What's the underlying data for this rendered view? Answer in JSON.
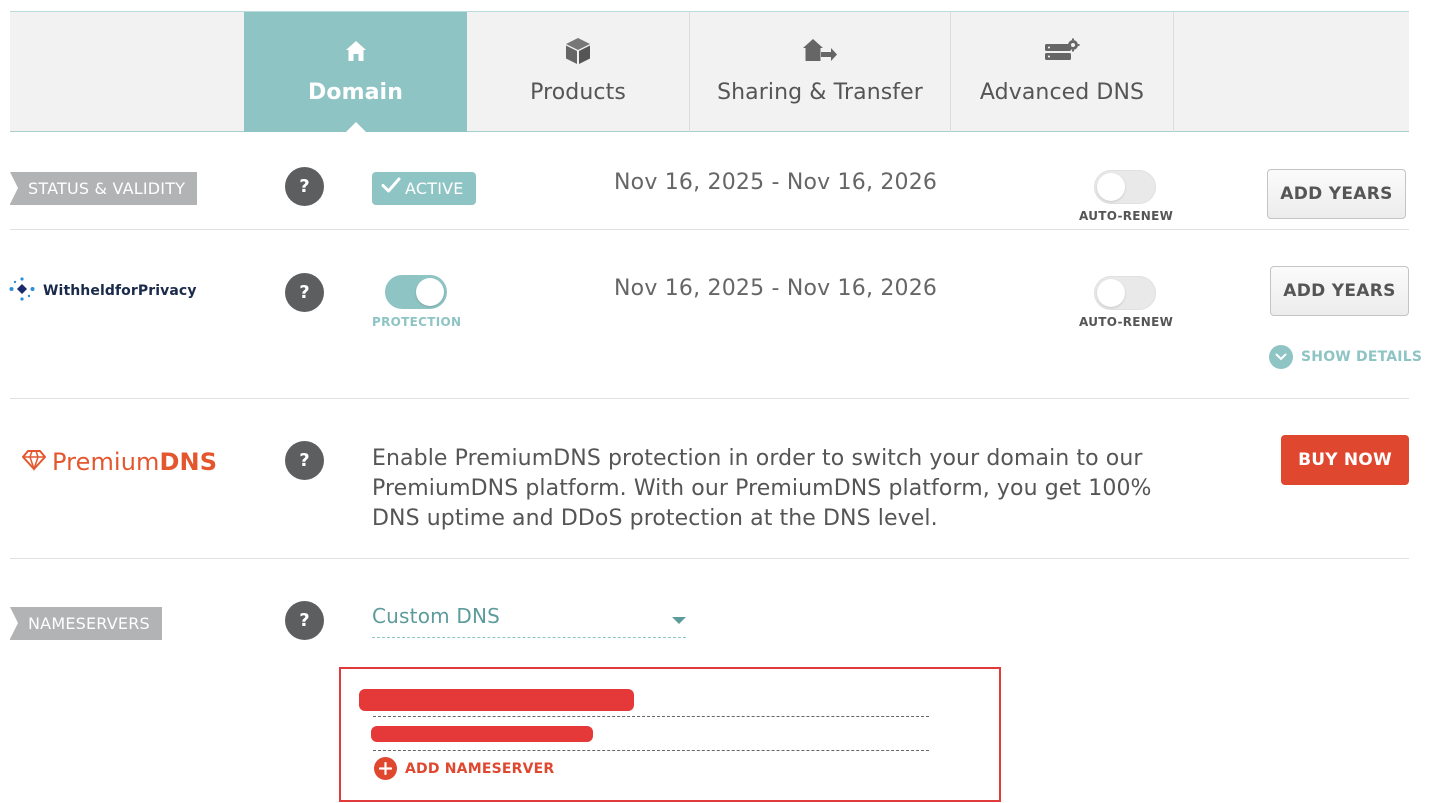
{
  "tabs": [
    {
      "label": "Domain",
      "icon": "home-icon",
      "active": true
    },
    {
      "label": "Products",
      "icon": "box-icon",
      "active": false
    },
    {
      "label": "Sharing & Transfer",
      "icon": "house-transfer-icon",
      "active": false
    },
    {
      "label": "Advanced DNS",
      "icon": "server-gear-icon",
      "active": false
    }
  ],
  "status_row": {
    "ribbon": "STATUS & VALIDITY",
    "badge": "ACTIVE",
    "dates": "Nov 16, 2025 - Nov 16, 2026",
    "auto_renew_label": "AUTO-RENEW",
    "auto_renew_on": false,
    "add_years": "ADD YEARS"
  },
  "privacy_row": {
    "logo_text": "WithheldforPrivacy",
    "protection_label": "PROTECTION",
    "protection_on": true,
    "dates": "Nov 16, 2025 - Nov 16, 2026",
    "auto_renew_label": "AUTO-RENEW",
    "auto_renew_on": false,
    "add_years": "ADD YEARS",
    "show_details": "SHOW DETAILS"
  },
  "premium_row": {
    "logo_light": "Premium",
    "logo_bold": "DNS",
    "description": "Enable PremiumDNS protection in order to switch your domain to our PremiumDNS platform. With our PremiumDNS platform, you get 100% DNS uptime and DDoS protection at the DNS level.",
    "buy_now": "BUY NOW"
  },
  "nameservers_row": {
    "ribbon": "NAMESERVERS",
    "selected": "Custom DNS",
    "add_nameserver": "ADD NAMESERVER"
  },
  "help_symbol": "?",
  "colors": {
    "teal": "#8ec4c3",
    "ribbon_grey": "#b1b3b4",
    "accent_red": "#e0472f",
    "highlight_box": "#e03a3a"
  }
}
